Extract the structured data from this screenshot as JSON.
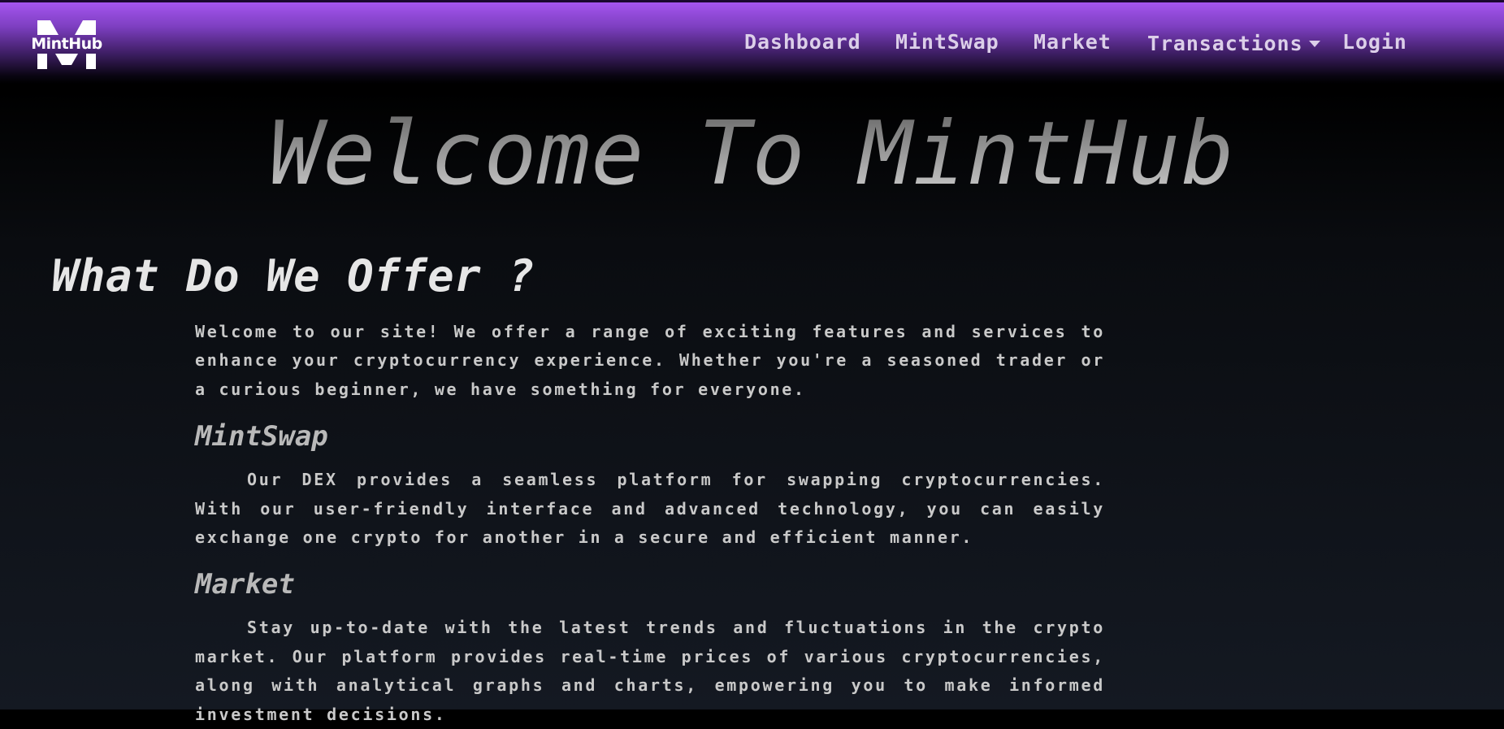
{
  "brand": {
    "name": "MintHub"
  },
  "nav": {
    "items": [
      "Dashboard",
      "MintSwap",
      "Market",
      "Transactions",
      "Login"
    ]
  },
  "hero": {
    "title": "Welcome To MintHub"
  },
  "offer": {
    "heading": "What Do We Offer ?",
    "intro": "Welcome to our site! We offer a range of exciting features and services to enhance your cryptocurrency experience. Whether you're a seasoned trader or a curious beginner, we have something for everyone.",
    "sections": [
      {
        "title": "MintSwap",
        "text": "Our DEX provides a seamless platform for swapping cryptocurrencies. With our user-friendly interface and advanced technology, you can easily exchange one crypto for another in a secure and efficient manner."
      },
      {
        "title": "Market",
        "text": "Stay up-to-date with the latest trends and fluctuations in the crypto market. Our platform provides real-time prices of various cryptocurrencies, along with analytical graphs and charts, empowering you to make informed investment decisions."
      }
    ]
  },
  "colors": {
    "accent": "#a555f0",
    "nav_text": "#dccfe9"
  }
}
